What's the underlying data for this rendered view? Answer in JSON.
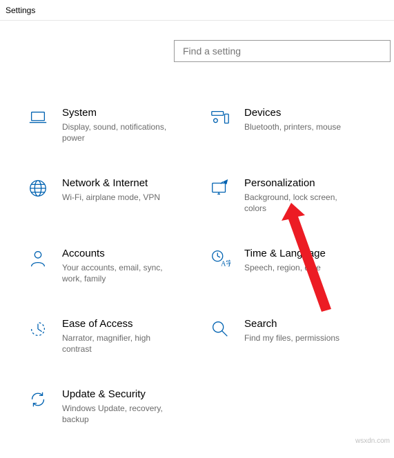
{
  "window": {
    "title": "Settings"
  },
  "search": {
    "placeholder": "Find a setting",
    "value": ""
  },
  "tiles": {
    "system": {
      "title": "System",
      "desc": "Display, sound, notifications, power"
    },
    "devices": {
      "title": "Devices",
      "desc": "Bluetooth, printers, mouse"
    },
    "network": {
      "title": "Network & Internet",
      "desc": "Wi-Fi, airplane mode, VPN"
    },
    "personalization": {
      "title": "Personalization",
      "desc": "Background, lock screen, colors"
    },
    "accounts": {
      "title": "Accounts",
      "desc": "Your accounts, email, sync, work, family"
    },
    "time": {
      "title": "Time & Language",
      "desc": "Speech, region, date"
    },
    "ease": {
      "title": "Ease of Access",
      "desc": "Narrator, magnifier, high contrast"
    },
    "search_tile": {
      "title": "Search",
      "desc": "Find my files, permissions"
    },
    "update": {
      "title": "Update & Security",
      "desc": "Windows Update, recovery, backup"
    }
  },
  "watermark": "wsxdn.com",
  "annotation": {
    "arrow_target": "personalization"
  },
  "colors": {
    "accent": "#0062b1",
    "arrow": "#ec1c24"
  }
}
